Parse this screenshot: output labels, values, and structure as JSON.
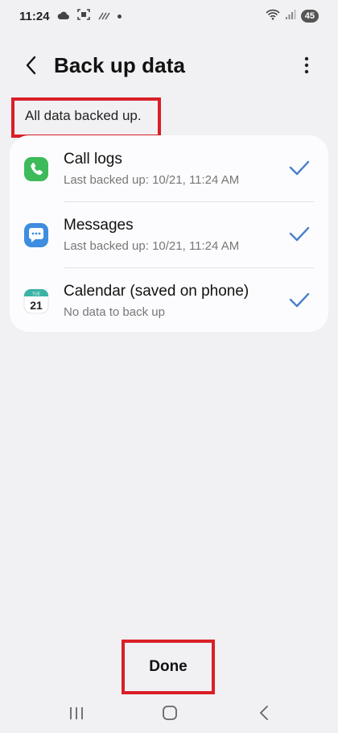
{
  "status_bar": {
    "time": "11:24",
    "battery": "45"
  },
  "header": {
    "title": "Back up data"
  },
  "status_message": "All data backed up.",
  "items": [
    {
      "title": "Call logs",
      "subtitle": "Last backed up: 10/21, 11:24 AM",
      "icon": "phone-icon",
      "checked": true
    },
    {
      "title": "Messages",
      "subtitle": "Last backed up: 10/21, 11:24 AM",
      "icon": "messages-icon",
      "checked": true
    },
    {
      "title": "Calendar (saved on phone)",
      "subtitle": "No data to back up",
      "icon": "calendar-icon",
      "checked": true
    }
  ],
  "calendar_icon": {
    "day_label": "TUE",
    "date": "21"
  },
  "done_label": "Done",
  "colors": {
    "background": "#f1f1f4",
    "card": "#fcfcfe",
    "check": "#4a7fc9",
    "highlight": "#d91f26",
    "phone_green": "#3dbb5a",
    "messages_blue": "#3d8de0",
    "calendar_teal": "#39b3a5"
  }
}
